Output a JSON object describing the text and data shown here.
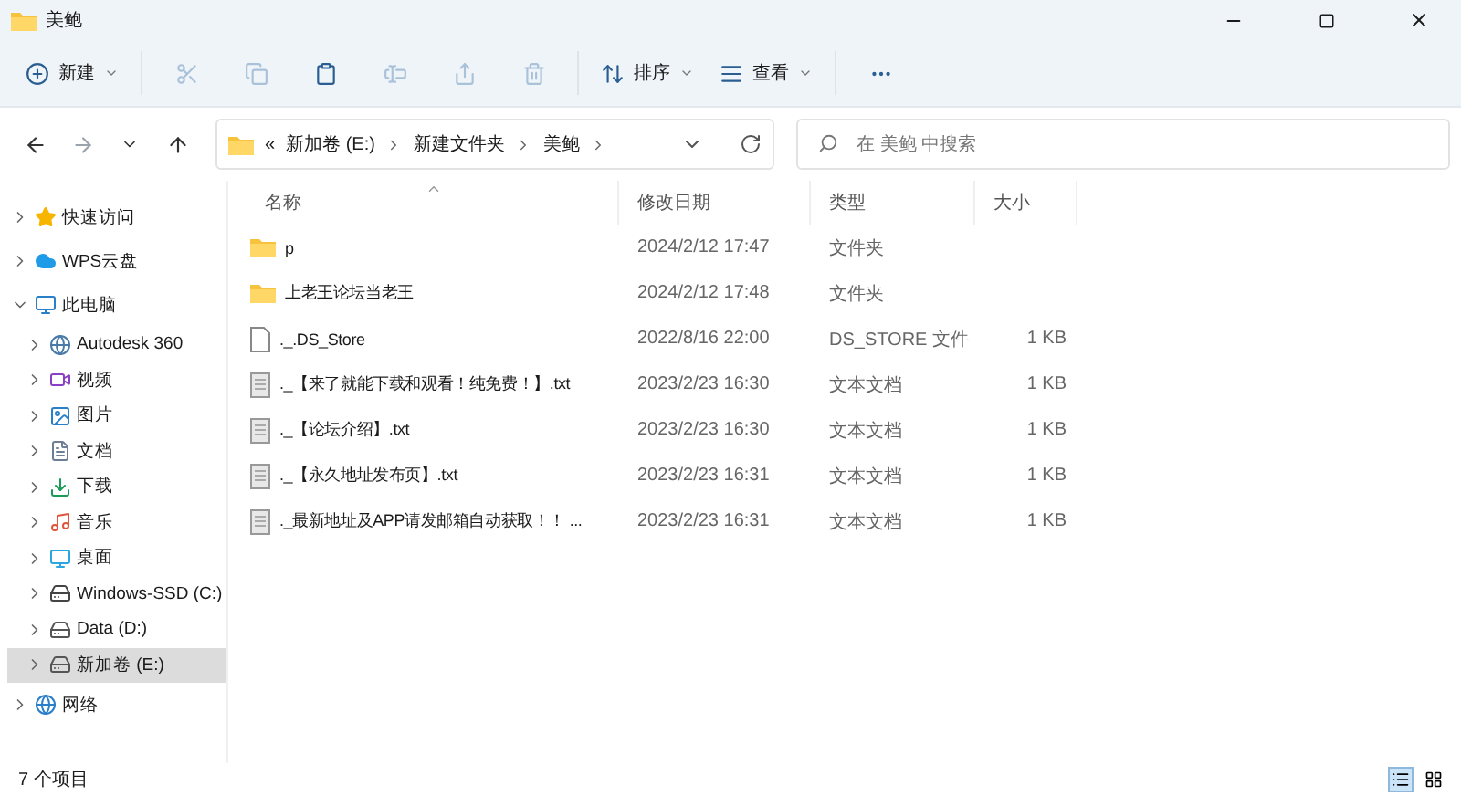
{
  "window": {
    "title": "美鲍"
  },
  "toolbar": [
    {
      "kind": "new",
      "label": "新建",
      "disabled": false
    },
    {
      "kind": "cut",
      "disabled": true
    },
    {
      "kind": "copy",
      "disabled": true
    },
    {
      "kind": "paste",
      "disabled": false
    },
    {
      "kind": "rename",
      "disabled": true
    },
    {
      "kind": "share",
      "disabled": true
    },
    {
      "kind": "delete",
      "disabled": true
    },
    {
      "kind": "sort",
      "label": "排序",
      "disabled": false
    },
    {
      "kind": "view",
      "label": "查看",
      "disabled": false
    },
    {
      "kind": "more",
      "disabled": false
    }
  ],
  "nav": {
    "back_disabled": false,
    "forward_disabled": true
  },
  "address": {
    "overflow": "«",
    "segments": [
      "新加卷 (E:)",
      "新建文件夹",
      "美鲍"
    ]
  },
  "search": {
    "placeholder": "在 美鲍 中搜索"
  },
  "sidebar": [
    {
      "kind": "star",
      "label": "快速访问",
      "expanded": false,
      "selected": false
    },
    {
      "kind": "cloud",
      "label": "WPS云盘",
      "expanded": false,
      "selected": false
    },
    {
      "kind": "pc",
      "label": "此电脑",
      "expanded": true,
      "selected": false,
      "children": [
        {
          "kind": "app",
          "label": "Autodesk 360",
          "expanded": false,
          "selected": false
        },
        {
          "kind": "video",
          "label": "视频",
          "expanded": false,
          "selected": false
        },
        {
          "kind": "picture",
          "label": "图片",
          "expanded": false,
          "selected": false
        },
        {
          "kind": "doc",
          "label": "文档",
          "expanded": false,
          "selected": false
        },
        {
          "kind": "download",
          "label": "下载",
          "expanded": false,
          "selected": false
        },
        {
          "kind": "music",
          "label": "音乐",
          "expanded": false,
          "selected": false
        },
        {
          "kind": "desktop",
          "label": "桌面",
          "expanded": false,
          "selected": false
        },
        {
          "kind": "sysdrive",
          "label": "Windows-SSD (C:)",
          "expanded": false,
          "selected": false
        },
        {
          "kind": "drive",
          "label": "Data (D:)",
          "expanded": false,
          "selected": false
        },
        {
          "kind": "drive",
          "label": "新加卷 (E:)",
          "expanded": false,
          "selected": true
        }
      ]
    },
    {
      "kind": "network",
      "label": "网络",
      "expanded": false,
      "selected": false
    }
  ],
  "columns": [
    "名称",
    "修改日期",
    "类型",
    "大小"
  ],
  "rows": [
    {
      "kind": "folder",
      "name": "p",
      "date": "2024/2/12 17:47",
      "type": "文件夹"
    },
    {
      "kind": "folder",
      "name": "上老王论坛当老王",
      "date": "2024/2/12 17:48",
      "type": "文件夹"
    },
    {
      "kind": "file",
      "name": "._.DS_Store",
      "date": "2022/8/16 22:00",
      "type": "DS_STORE 文件",
      "size": "1 KB"
    },
    {
      "kind": "text",
      "name": "._【来了就能下载和观看！纯免费！】.txt",
      "date": "2023/2/23 16:30",
      "type": "文本文档",
      "size": "1 KB"
    },
    {
      "kind": "text",
      "name": "._【论坛介绍】.txt",
      "date": "2023/2/23 16:30",
      "type": "文本文档",
      "size": "1 KB"
    },
    {
      "kind": "text",
      "name": "._【永久地址发布页】.txt",
      "date": "2023/2/23 16:31",
      "type": "文本文档",
      "size": "1 KB"
    },
    {
      "kind": "text",
      "name": "._最新地址及APP请发邮箱自动获取！！ ...",
      "date": "2023/2/23 16:31",
      "type": "文本文档",
      "size": "1 KB"
    }
  ],
  "status": "7 个项目",
  "views": [
    {
      "kind": "details",
      "selected": true
    },
    {
      "kind": "tiles",
      "selected": false
    }
  ]
}
